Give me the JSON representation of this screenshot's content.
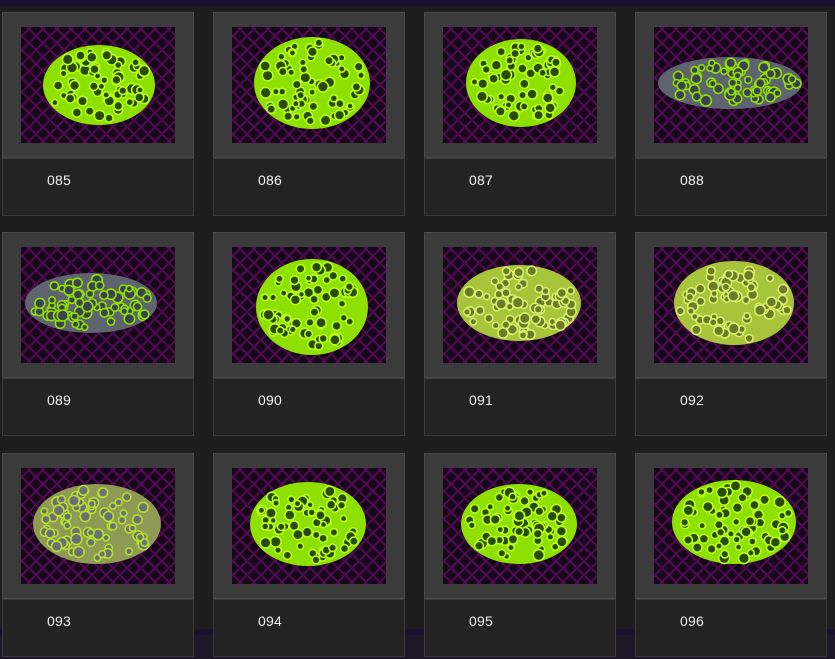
{
  "gallery": {
    "items": [
      {
        "label": "085",
        "style": "lime"
      },
      {
        "label": "086",
        "style": "lime"
      },
      {
        "label": "087",
        "style": "lime"
      },
      {
        "label": "088",
        "style": "grey-lime"
      },
      {
        "label": "089",
        "style": "grey-lime"
      },
      {
        "label": "090",
        "style": "lime"
      },
      {
        "label": "091",
        "style": "pale-tentacle"
      },
      {
        "label": "092",
        "style": "pale-tentacle"
      },
      {
        "label": "093",
        "style": "pale-grey"
      },
      {
        "label": "094",
        "style": "lime"
      },
      {
        "label": "095",
        "style": "lime"
      },
      {
        "label": "096",
        "style": "lime"
      }
    ]
  },
  "colors": {
    "page_background": "#1d1d1d",
    "frame_grey": "#3b3b3b",
    "caption_background": "#232323",
    "caption_text": "#f2f2f2",
    "coral_lime": "#8ee000",
    "coral_dark": "#2a4a06",
    "tank_magenta": "#5a0f5a",
    "tank_dark": "#18061b"
  }
}
